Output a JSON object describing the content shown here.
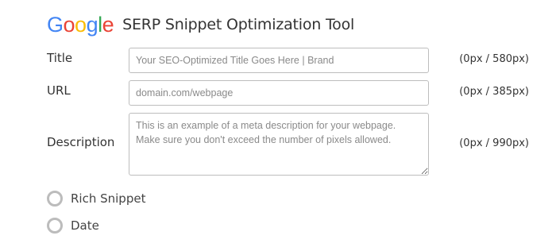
{
  "header": {
    "logo_letters": [
      {
        "char": "G",
        "color": "#4285F4"
      },
      {
        "char": "o",
        "color": "#EA4335"
      },
      {
        "char": "o",
        "color": "#FBBC05"
      },
      {
        "char": "g",
        "color": "#4285F4"
      },
      {
        "char": "l",
        "color": "#34A853"
      },
      {
        "char": "e",
        "color": "#EA4335"
      }
    ],
    "title": "SERP Snippet Optimization Tool"
  },
  "fields": {
    "title": {
      "label": "Title",
      "placeholder": "Your SEO-Optimized Title Goes Here | Brand",
      "value": "",
      "pixel_count": "(0px / 580px)"
    },
    "url": {
      "label": "URL",
      "placeholder": "domain.com/webpage",
      "value": "",
      "pixel_count": "(0px / 385px)"
    },
    "description": {
      "label": "Description",
      "placeholder": "This is an example of a meta description for your webpage. Make sure you don't exceed the number of pixels allowed.",
      "value": "",
      "pixel_count": "(0px / 990px)"
    }
  },
  "options": [
    {
      "label": "Rich Snippet",
      "checked": false
    },
    {
      "label": "Date",
      "checked": false
    }
  ]
}
